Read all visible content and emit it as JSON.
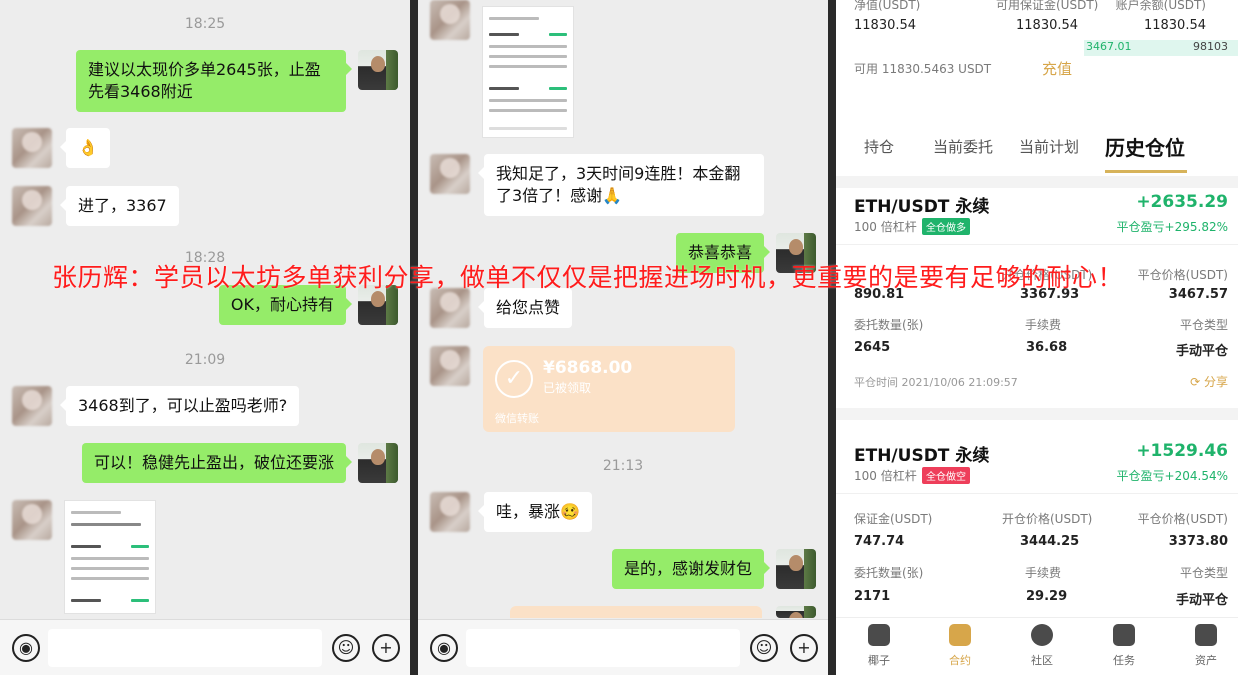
{
  "banner": "张历辉：学员以太坊多单获利分享，做单不仅仅是把握进场时机，更重要的是要有足够的耐心！",
  "chat1": {
    "ts1": "18:25",
    "msg1": "建议以太现价多单2645张，止盈先看3468附近",
    "msg2": "👌",
    "msg3": "进了，3367",
    "ts2": "18:28",
    "msg4": "OK，耐心持有",
    "ts3": "21:09",
    "msg5": "3468到了，可以止盈吗老师?",
    "msg6": "可以！稳健先止盈出，破位还要涨"
  },
  "chat2": {
    "msg1": "我知足了，3天时间9连胜！本金翻了3倍了！感谢🙏",
    "msg2": "恭喜恭喜",
    "msg3": "给您点赞",
    "redpacket": {
      "amount": "¥6868.00",
      "status": "已被领取",
      "source": "微信转账"
    },
    "ts1": "21:13",
    "msg4": "哇，暴涨🥴",
    "msg5": "是的，感谢发财包"
  },
  "trade": {
    "header_labels": [
      "净值(USDT)",
      "可用保证金(USDT)",
      "账户余额(USDT)"
    ],
    "header_values": [
      "11830.54",
      "11830.54",
      "11830.54"
    ],
    "peek_values": [
      "3467.01",
      "98103"
    ],
    "available": "可用 11830.5463 USDT",
    "recharge": "充值",
    "tabs": [
      "持仓",
      "当前委托",
      "当前计划",
      "历史仓位"
    ],
    "pos1": {
      "symbol": "ETH/USDT 永续",
      "leverage": "100 倍杠杆",
      "badge": "全仓做多",
      "pnl": "+2635.29",
      "pct": "平仓盈亏+295.82%",
      "margin_val": "890.81",
      "open_label": "开仓价格(USDT)",
      "open_val": "3367.93",
      "close_label": "平仓价格(USDT)",
      "close_val": "3467.57",
      "qty_label": "委托数量(张)",
      "qty_val": "2645",
      "fee_label": "手续费",
      "fee_val": "36.68",
      "type_label": "平仓类型",
      "type_val": "手动平仓",
      "time": "平仓时间 2021/10/06 21:09:57",
      "share": "分享"
    },
    "pos2": {
      "symbol": "ETH/USDT 永续",
      "leverage": "100 倍杠杆",
      "badge": "全仓做空",
      "pnl": "+1529.46",
      "pct": "平仓盈亏+204.54%",
      "margin_label": "保证金(USDT)",
      "margin_val": "747.74",
      "open_label": "开仓价格(USDT)",
      "open_val": "3444.25",
      "close_label": "平仓价格(USDT)",
      "close_val": "3373.80",
      "qty_label": "委托数量(张)",
      "qty_val": "2171",
      "fee_label": "手续费",
      "fee_val": "29.29",
      "type_label": "平仓类型",
      "type_val": "手动平仓"
    },
    "nav": [
      "椰子",
      "合约",
      "社区",
      "任务",
      "资产"
    ]
  },
  "colors": {
    "bubble_me": "#95ec69",
    "profit": "#1fb36b",
    "accent": "#d7b35a",
    "banner": "#ff1c1c"
  }
}
